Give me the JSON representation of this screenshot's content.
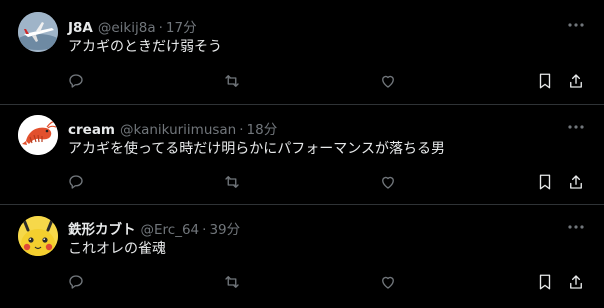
{
  "colors": {
    "background": "#000000",
    "divider": "#2f3336",
    "primary_text": "#e7e9ea",
    "secondary_text": "#71767b"
  },
  "posts": [
    {
      "avatar_icon": "airplane-avatar",
      "name": "J8A",
      "handle": "@eikij8a",
      "separator": "·",
      "time": "17分",
      "text": "アカギのときだけ弱そう"
    },
    {
      "avatar_icon": "shrimp-avatar",
      "name": "cream",
      "handle": "@kanikuriimusan",
      "separator": "·",
      "time": "18分",
      "text": "アカギを使ってる時だけ明らかにパフォーマンスが落ちる男"
    },
    {
      "avatar_icon": "pikachu-avatar",
      "name": "鉄形カブト",
      "handle": "@Erc_64",
      "separator": "·",
      "time": "39分",
      "text": "これオレの雀魂"
    }
  ],
  "actions": [
    "reply-icon",
    "repost-icon",
    "like-icon",
    "bookmark-icon",
    "share-icon"
  ]
}
